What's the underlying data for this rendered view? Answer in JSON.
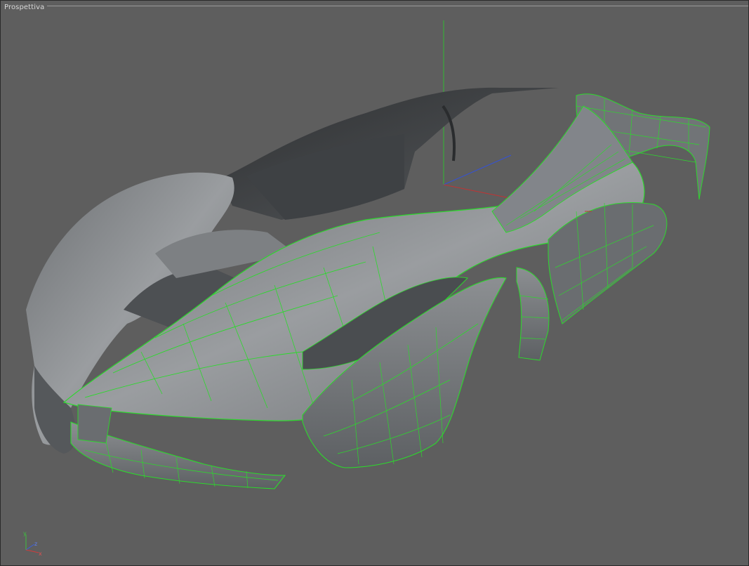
{
  "viewport": {
    "title": "Prospettiva",
    "background": "#5e5e5e"
  },
  "gizmo": {
    "x_label": "x",
    "y_label": "y",
    "z_label": "z",
    "x_color": "#d23a3a",
    "y_color": "#3fbf3f",
    "z_color": "#3b5fe0"
  },
  "model": {
    "shell_color": "#8a8d90",
    "wireframe_color": "#2cd92c"
  }
}
